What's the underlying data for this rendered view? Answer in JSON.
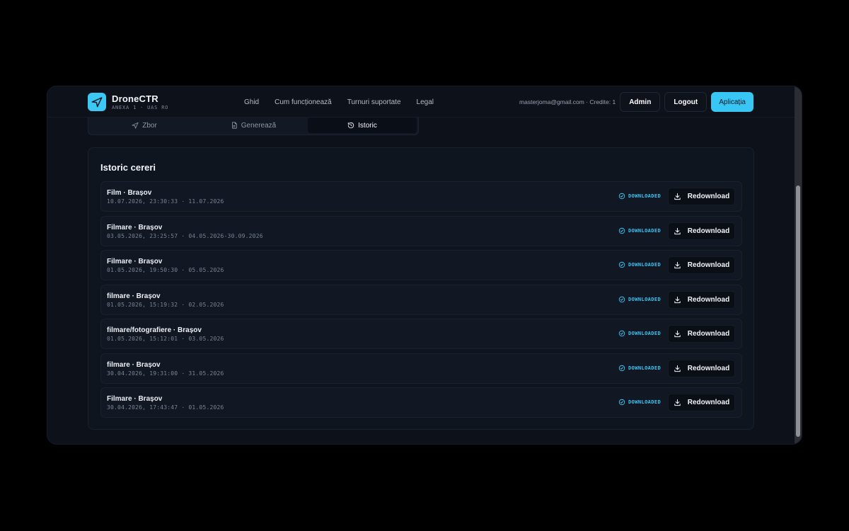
{
  "brand": {
    "name": "DroneCTR",
    "subtitle": "ANEXA 1 · UAS RO"
  },
  "nav": [
    "Ghid",
    "Cum funcționează",
    "Turnuri suportate",
    "Legal"
  ],
  "account": {
    "info": "masterjoma@gmail.com · Credite: 1",
    "admin_label": "Admin",
    "logout_label": "Logout",
    "app_label": "Aplicația"
  },
  "tabs": [
    {
      "label": "Zbor",
      "icon": "drone-icon",
      "active": false
    },
    {
      "label": "Generează",
      "icon": "document-icon",
      "active": false
    },
    {
      "label": "Istoric",
      "icon": "history-icon",
      "active": true
    }
  ],
  "history": {
    "title": "Istoric cereri",
    "status_label": "DOWNLOADED",
    "action_label": "Redownload",
    "rows": [
      {
        "title": "Film · Brașov",
        "meta": "10.07.2026, 23:30:33 · 11.07.2026"
      },
      {
        "title": "Filmare · Brașov",
        "meta": "03.05.2026, 23:25:57 · 04.05.2026-30.09.2026"
      },
      {
        "title": "Filmare · Brașov",
        "meta": "01.05.2026, 19:50:30 · 05.05.2026"
      },
      {
        "title": "filmare · Brașov",
        "meta": "01.05.2026, 15:19:32 · 02.05.2026"
      },
      {
        "title": "filmare/fotografiere · Brașov",
        "meta": "01.05.2026, 15:12:01 · 03.05.2026"
      },
      {
        "title": "filmare · Brașov",
        "meta": "30.04.2026, 19:31:00 · 31.05.2026"
      },
      {
        "title": "Filmare · Brașov",
        "meta": "30.04.2026, 17:43:47 · 01.05.2026"
      }
    ]
  },
  "colors": {
    "accent": "#38c6f4",
    "background": "#0c111a",
    "card": "#0f151f"
  }
}
